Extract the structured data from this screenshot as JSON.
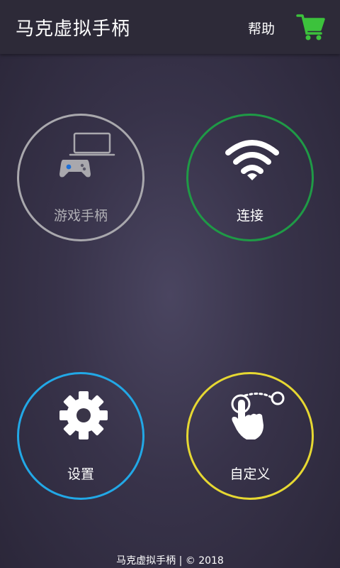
{
  "header": {
    "title": "马克虚拟手柄",
    "help_label": "帮助",
    "cart_icon": "shopping-cart-icon",
    "cart_color": "#3cc23c"
  },
  "tiles": [
    {
      "label": "游戏手柄",
      "icon": "gamepad-laptop-icon",
      "ring_color": "#a9a8ad"
    },
    {
      "label": "连接",
      "icon": "wifi-icon",
      "ring_color": "#1f9a46"
    },
    {
      "label": "设置",
      "icon": "gear-icon",
      "ring_color": "#22a8e6"
    },
    {
      "label": "自定义",
      "icon": "touch-gesture-icon",
      "ring_color": "#e6d832"
    }
  ],
  "footer": {
    "text": "马克虚拟手柄 | © 2018"
  }
}
